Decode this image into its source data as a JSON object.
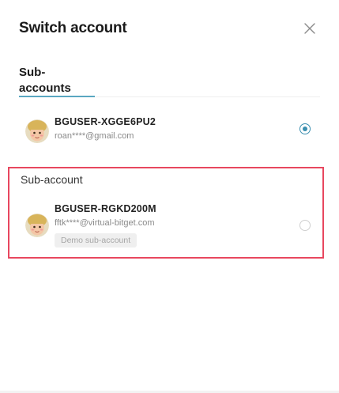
{
  "header": {
    "title": "Switch account"
  },
  "tabs": [
    {
      "label": "Sub-accounts",
      "active": true
    }
  ],
  "accounts": [
    {
      "name": "BGUSER-XGGE6PU2",
      "email": "roan****@gmail.com",
      "selected": true
    },
    {
      "section_label": "Sub-account",
      "name": "BGUSER-RGKD200M",
      "email": "fftk****@virtual-bitget.com",
      "badge": "Demo sub-account",
      "selected": false
    }
  ],
  "colors": {
    "accent": "#3b8fb0",
    "tab_underline": "#5aa7c1",
    "highlight": "#e8475f"
  },
  "icons": {
    "close": "close-icon",
    "avatar": "avatar-icon"
  }
}
